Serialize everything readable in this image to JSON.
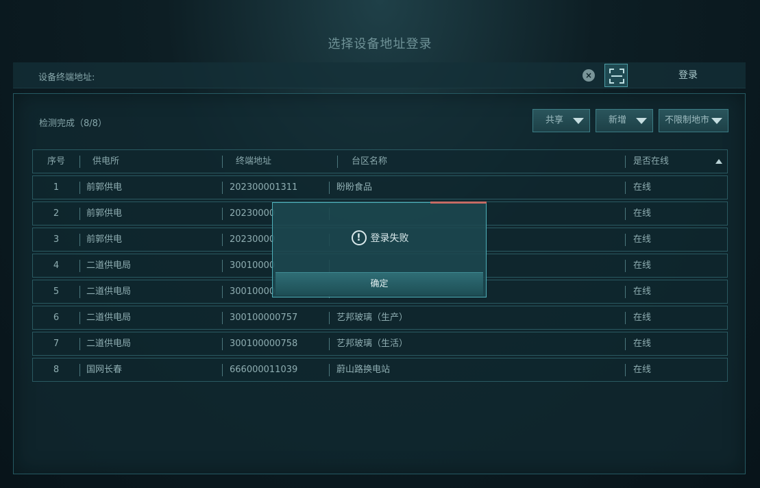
{
  "title": "选择设备地址登录",
  "address_bar": {
    "label": "设备终端地址:",
    "value": "",
    "clear_icon": "clear-circle-icon",
    "scan_icon": "scan-icon",
    "login_label": "登录"
  },
  "panel": {
    "status": "检测完成（8/8）",
    "buttons": {
      "share": "共享",
      "new": "新增",
      "city": "不限制地市"
    }
  },
  "table": {
    "headers": [
      "序号",
      "供电所",
      "终端地址",
      "台区名称",
      "是否在线"
    ],
    "rows": [
      {
        "no": "1",
        "station": "前郭供电",
        "address": "202300001311",
        "area": "盼盼食品",
        "online": "在线"
      },
      {
        "no": "2",
        "station": "前郭供电",
        "address": "20230000",
        "area": "",
        "online": "在线"
      },
      {
        "no": "3",
        "station": "前郭供电",
        "address": "20230000",
        "area": "",
        "online": "在线"
      },
      {
        "no": "4",
        "station": "二道供电局",
        "address": "30010000",
        "area": "",
        "online": "在线"
      },
      {
        "no": "5",
        "station": "二道供电局",
        "address": "30010000",
        "area": "",
        "online": "在线"
      },
      {
        "no": "6",
        "station": "二道供电局",
        "address": "300100000757",
        "area": "艺邦玻璃（生产）",
        "online": "在线"
      },
      {
        "no": "7",
        "station": "二道供电局",
        "address": "300100000758",
        "area": "艺邦玻璃（生活）",
        "online": "在线"
      },
      {
        "no": "8",
        "station": "国网长春",
        "address": "666000011039",
        "area": "蔚山路换电站",
        "online": "在线"
      }
    ]
  },
  "dialog": {
    "message": "登录失败",
    "icon": "exclamation-circle-icon",
    "confirm_label": "确定"
  },
  "colors": {
    "accent_border": "#4fb1bb",
    "dialog_accent": "#c66b64"
  }
}
